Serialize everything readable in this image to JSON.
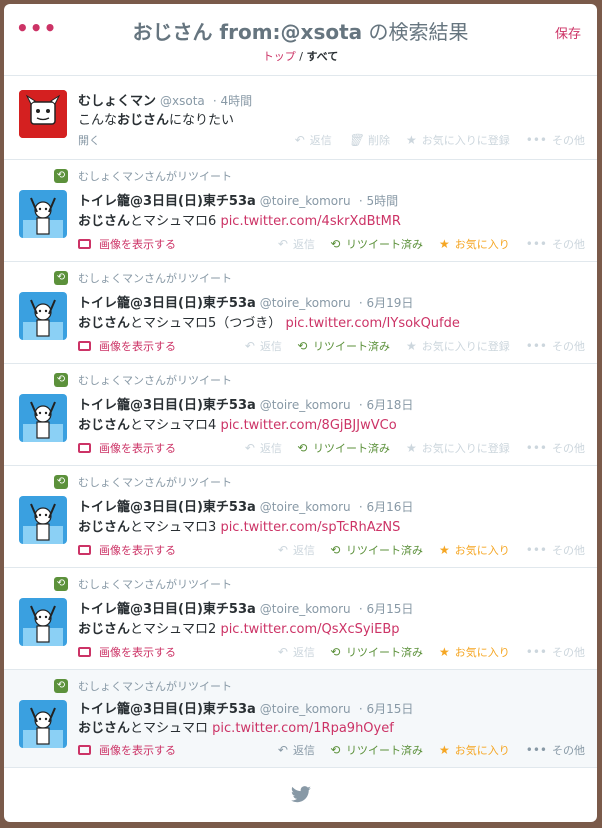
{
  "header": {
    "menu_icon": "more-dots-icon",
    "title_query": "おじさん from:@xsota",
    "title_suffix": " の検索結果",
    "save_label": "保存",
    "crumb_top": "トップ",
    "crumb_sep": " / ",
    "crumb_all": "すべて"
  },
  "tweets": [
    {
      "name": "むしょくマン",
      "screen_name": "@xsota",
      "time": "· 4時間",
      "text_pre": "こんな",
      "text_bold": "おじさん",
      "text_post": "になりたい",
      "expand": "開く",
      "reply": "返信",
      "delete": "削除",
      "favorite": "お気に入りに登録",
      "more": "その他"
    },
    {
      "retweeted_by": "むしょくマンさんがリツイート",
      "name": "トイレ籠@3日目(日)東チ53a",
      "screen_name": "@toire_komoru",
      "time": "· 5時間",
      "text_bold": "おじさん",
      "text_post": "とマシュマロ6",
      "link": "pic.twitter.com/4skrXdBtMR",
      "media": "画像を表示する",
      "reply": "返信",
      "retweet": "リツイート済み",
      "favorite": "お気に入り",
      "more": "その他"
    },
    {
      "retweeted_by": "むしょくマンさんがリツイート",
      "name": "トイレ籠@3日目(日)東チ53a",
      "screen_name": "@toire_komoru",
      "time": "· 6月19日",
      "text_bold": "おじさん",
      "text_post": "とマシュマロ5（つづき）",
      "link": "pic.twitter.com/IYsokQufde",
      "media": "画像を表示する",
      "reply": "返信",
      "retweet": "リツイート済み",
      "favorite": "お気に入りに登録",
      "more": "その他"
    },
    {
      "retweeted_by": "むしょくマンさんがリツイート",
      "name": "トイレ籠@3日目(日)東チ53a",
      "screen_name": "@toire_komoru",
      "time": "· 6月18日",
      "text_bold": "おじさん",
      "text_post": "とマシュマロ4",
      "link": "pic.twitter.com/8GjBJJwVCo",
      "media": "画像を表示する",
      "reply": "返信",
      "retweet": "リツイート済み",
      "favorite": "お気に入りに登録",
      "more": "その他"
    },
    {
      "retweeted_by": "むしょくマンさんがリツイート",
      "name": "トイレ籠@3日目(日)東チ53a",
      "screen_name": "@toire_komoru",
      "time": "· 6月16日",
      "text_bold": "おじさん",
      "text_post": "とマシュマロ3",
      "link": "pic.twitter.com/spTcRhAzNS",
      "media": "画像を表示する",
      "reply": "返信",
      "retweet": "リツイート済み",
      "favorite": "お気に入り",
      "more": "その他"
    },
    {
      "retweeted_by": "むしょくマンさんがリツイート",
      "name": "トイレ籠@3日目(日)東チ53a",
      "screen_name": "@toire_komoru",
      "time": "· 6月15日",
      "text_bold": "おじさん",
      "text_post": "とマシュマロ2",
      "link": "pic.twitter.com/QsXcSyiEBp",
      "media": "画像を表示する",
      "reply": "返信",
      "retweet": "リツイート済み",
      "favorite": "お気に入り",
      "more": "その他"
    },
    {
      "retweeted_by": "むしょくマンさんがリツイート",
      "name": "トイレ籠@3日目(日)東チ53a",
      "screen_name": "@toire_komoru",
      "time": "· 6月15日",
      "text_bold": "おじさん",
      "text_post": "とマシュマロ",
      "link": "pic.twitter.com/1Rpa9hOyef",
      "media": "画像を表示する",
      "reply": "返信",
      "retweet": "リツイート済み",
      "favorite": "お気に入り",
      "more": "その他"
    }
  ],
  "footer": {
    "icon": "twitter-bird-icon"
  },
  "colors": {
    "accent": "#cc3366",
    "retweet": "#5c913b",
    "favorite": "#f5a623",
    "muted": "#8899a6"
  }
}
